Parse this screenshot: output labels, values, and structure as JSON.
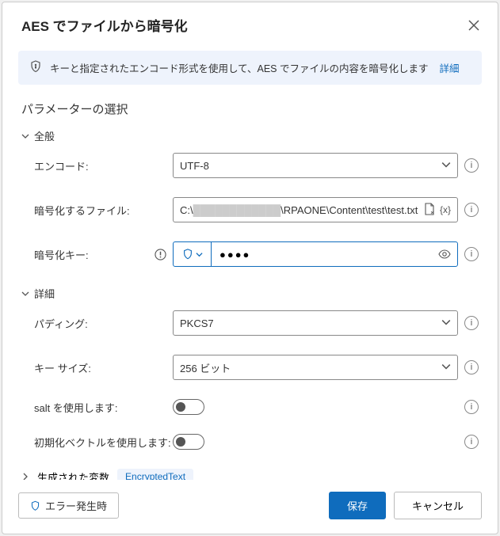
{
  "header": {
    "title": "AES でファイルから暗号化"
  },
  "banner": {
    "text": "キーと指定されたエンコード形式を使用して、AES でファイルの内容を暗号化します",
    "link_label": "詳細"
  },
  "section_title": "パラメーターの選択",
  "groups": {
    "general": {
      "label": "全般"
    },
    "details": {
      "label": "詳細"
    },
    "generated": {
      "label": "生成された変数"
    }
  },
  "fields": {
    "encoding": {
      "label": "エンコード:",
      "value": "UTF-8"
    },
    "file": {
      "label": "暗号化するファイル:",
      "prefix": "C:\\",
      "obscured": "████████████",
      "suffix": "\\RPAONE\\Content\\test\\test.txt"
    },
    "key": {
      "label": "暗号化キー:",
      "value": "●●●●"
    },
    "padding": {
      "label": "パディング:",
      "value": "PKCS7"
    },
    "keysize": {
      "label": "キー サイズ:",
      "value": "256 ビット"
    },
    "use_salt": {
      "label": "salt を使用します:"
    },
    "use_iv": {
      "label": "初期化ベクトルを使用します:"
    }
  },
  "generated_var": "EncryptedText",
  "footer": {
    "on_error": "エラー発生時",
    "save": "保存",
    "cancel": "キャンセル"
  },
  "fx_label": "{x}"
}
